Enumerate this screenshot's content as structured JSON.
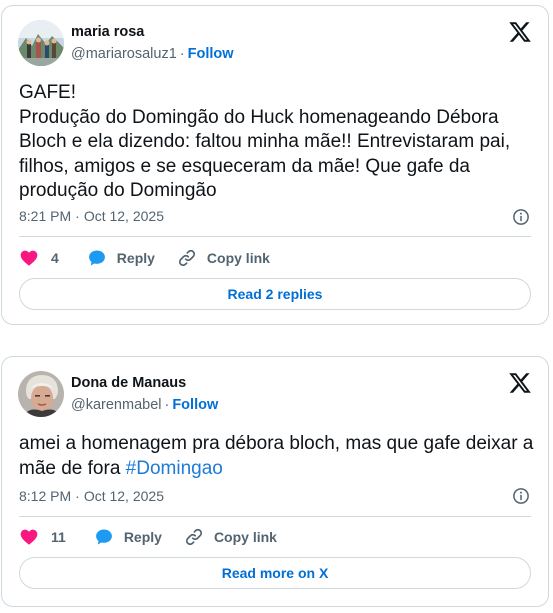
{
  "tweets": [
    {
      "author_name": "maria rosa",
      "handle": "@mariarosaluz1",
      "separator": "·",
      "follow_label": "Follow",
      "text": "GAFE!\nProdução do Domingão do Huck homenageando Débora Bloch e ela dizendo: faltou minha mãe!! Entrevistaram pai, filhos, amigos e se esqueceram da mãe! Que gafe da produção do Domingão",
      "time": "8:21 PM",
      "date": "Oct 12, 2025",
      "likes": "4",
      "reply_label": "Reply",
      "copy_label": "Copy link",
      "button_label": "Read 2 replies"
    },
    {
      "author_name": "Dona de Manaus",
      "handle": "@karenmabel",
      "separator": "·",
      "follow_label": "Follow",
      "text_main": "amei a homenagem pra débora bloch, mas que gafe deixar a mãe de fora ",
      "hashtag": "#Domingao",
      "time": "8:12 PM",
      "date": "Oct 12, 2025",
      "likes": "11",
      "reply_label": "Reply",
      "copy_label": "Copy link",
      "button_label": "Read more on X"
    }
  ],
  "colors": {
    "like": "#f91880",
    "reply": "#1d9bf0",
    "link": "#006fd6",
    "muted": "#536471",
    "border": "#cfd9de"
  },
  "icons": [
    "x-logo-icon",
    "info-icon",
    "heart-icon",
    "speech-bubble-icon",
    "link-icon"
  ]
}
